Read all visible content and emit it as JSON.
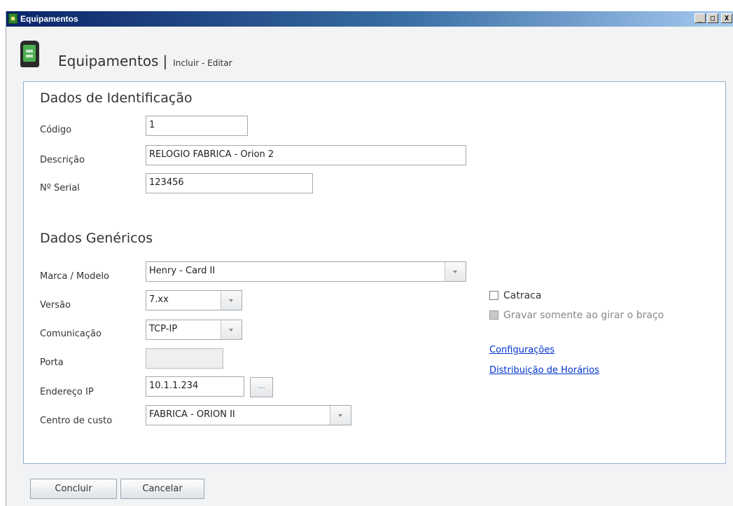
{
  "window": {
    "title": "Equipamentos",
    "controls": [
      "_",
      "□",
      "X"
    ]
  },
  "header": {
    "title": "Equipamentos",
    "separator": "|",
    "subtitle": "Incluir - Editar"
  },
  "identificacao": {
    "section_title": "Dados de Identificação",
    "codigo": {
      "label": "Código",
      "value": "1"
    },
    "descricao": {
      "label": "Descrição",
      "value": "RELOGIO FABRICA - Orion 2"
    },
    "serial": {
      "label": "Nº Serial",
      "value": "123456"
    }
  },
  "genericos": {
    "section_title": "Dados Genéricos",
    "marca_modelo": {
      "label": "Marca / Modelo",
      "value": "Henry - Card II"
    },
    "versao": {
      "label": "Versão",
      "value": "7.xx"
    },
    "comunicacao": {
      "label": "Comunicação",
      "value": "TCP-IP"
    },
    "porta": {
      "label": "Porta",
      "value": ""
    },
    "endereco_ip": {
      "label": "Endereço IP",
      "value": "10.1.1.234",
      "button_label": "..."
    },
    "centro_custo": {
      "label": "Centro de custo",
      "value": "FABRICA - ORION II"
    },
    "catraca": {
      "label": "Catraca",
      "checked": false
    },
    "gravar": {
      "label": "Gravar somente ao girar o braço",
      "checked": false,
      "disabled": true
    },
    "links": {
      "configuracoes": "Configurações",
      "distribuicao": "Distribuição de Horários"
    }
  },
  "actions": {
    "concluir": "Concluir",
    "cancelar": "Cancelar"
  },
  "icons": {
    "title_icon": "equipment-icon",
    "header_icon": "time-clock-device-icon",
    "dropdown_icon": "chevron-down-icon"
  },
  "colors": {
    "titlebar_start": "#0a246a",
    "titlebar_end": "#a6caf0",
    "panel_border": "#8fb0cf",
    "link": "#0033cc"
  }
}
